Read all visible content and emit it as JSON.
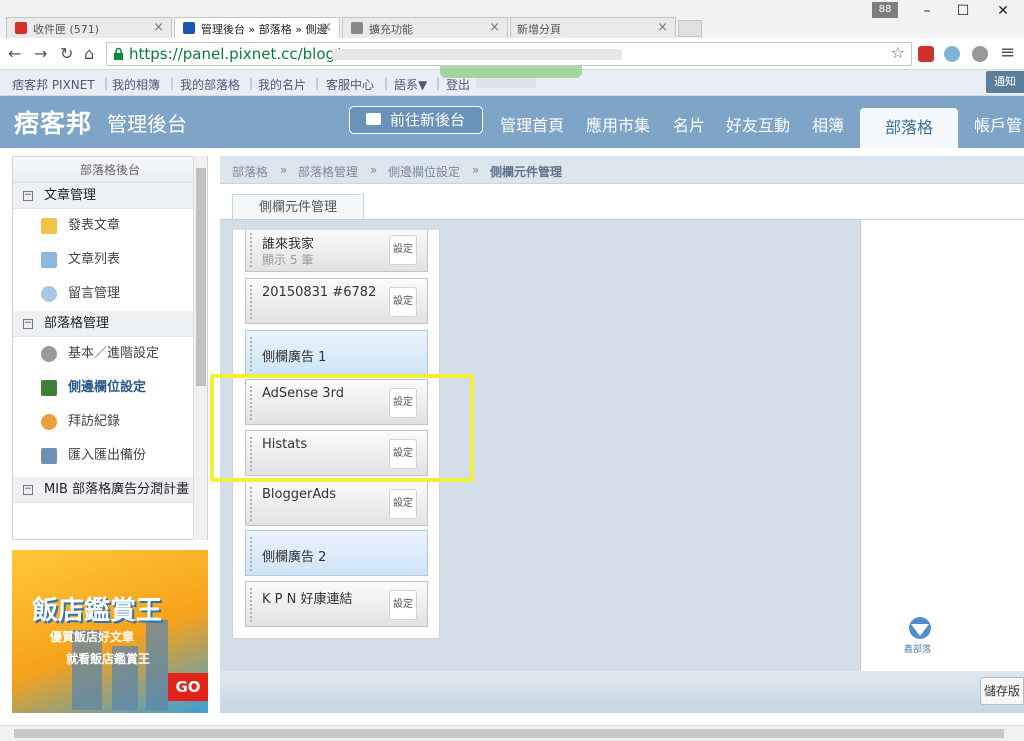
{
  "browser": {
    "tabs": [
      {
        "label": "收件匣 (571)",
        "favicon": "gmail-icon",
        "color": "#d93025"
      },
      {
        "label": "管理後台 » 部落格 » 側邊",
        "favicon": "pixnet-icon",
        "color": "#1a56b8"
      },
      {
        "label": "擴充功能",
        "favicon": "puzzle-icon",
        "color": "#666666"
      },
      {
        "label": "新增分頁",
        "favicon": "",
        "color": ""
      }
    ],
    "tab_counter": "88",
    "url": "https://panel.pixnet.cc/blog/s"
  },
  "site": {
    "top_links": [
      "痞客邦 PIXNET",
      "我的相簿",
      "我的部落格",
      "我的名片",
      "客服中心",
      "語系▼",
      "登出"
    ],
    "notify": "通知",
    "logo": "痞客邦",
    "logo_sub": "管理後台",
    "new_admin": "前往新後台",
    "nav": [
      "管理首頁",
      "應用市集",
      "名片",
      "好友互動",
      "相簿"
    ],
    "nav_active": "部落格",
    "nav_cut": "帳戶管"
  },
  "sidebar": {
    "title": "部落格後台",
    "sections": [
      {
        "label": "文章管理",
        "items": [
          {
            "label": "發表文章",
            "icon": "pencil-icon"
          },
          {
            "label": "文章列表",
            "icon": "documents-icon"
          },
          {
            "label": "留言管理",
            "icon": "comment-icon"
          }
        ]
      },
      {
        "label": "部落格管理",
        "items": [
          {
            "label": "基本／進階設定",
            "icon": "gear-icon"
          },
          {
            "label": "側邊欄位設定",
            "icon": "layout-icon"
          },
          {
            "label": "拜訪紀錄",
            "icon": "users-icon"
          },
          {
            "label": "匯入匯出備份",
            "icon": "copy-icon"
          }
        ]
      },
      {
        "label": "MIB 部落格廣告分潤計畫",
        "items": []
      }
    ]
  },
  "ad": {
    "title": "飯店鑑賞王",
    "line1": "優質飯店好文章",
    "line2": "就看飯店鑑賞王",
    "cta": "GO"
  },
  "breadcrumb": [
    "部落格",
    "部落格管理",
    "側邊欄位設定",
    "側欄元件管理"
  ],
  "tab_label": "側欄元件管理",
  "widgets": [
    {
      "name": "誰來我家",
      "sub": "顯示 5 筆",
      "set": "設定",
      "type": "normal"
    },
    {
      "name": "20150831 #6782",
      "sub": "",
      "set": "設定",
      "type": "normal"
    },
    {
      "name": "側欄廣告 1",
      "sub": "",
      "set": "",
      "type": "ad"
    },
    {
      "name": "AdSense 3rd",
      "sub": "",
      "set": "設定",
      "type": "normal"
    },
    {
      "name": "Histats",
      "sub": "",
      "set": "設定",
      "type": "normal"
    },
    {
      "name": "BloggerAds",
      "sub": "",
      "set": "設定",
      "type": "normal"
    },
    {
      "name": "側欄廣告 2",
      "sub": "",
      "set": "",
      "type": "ad"
    },
    {
      "name": "K P N 好康連結",
      "sub": "",
      "set": "設定",
      "type": "normal"
    }
  ],
  "save_label": "儲存版",
  "watermark": "鑫部落",
  "colors": {
    "header": "#7ea4c8",
    "highlight": "#f0ef3a",
    "accent": "#3b6f9a"
  }
}
